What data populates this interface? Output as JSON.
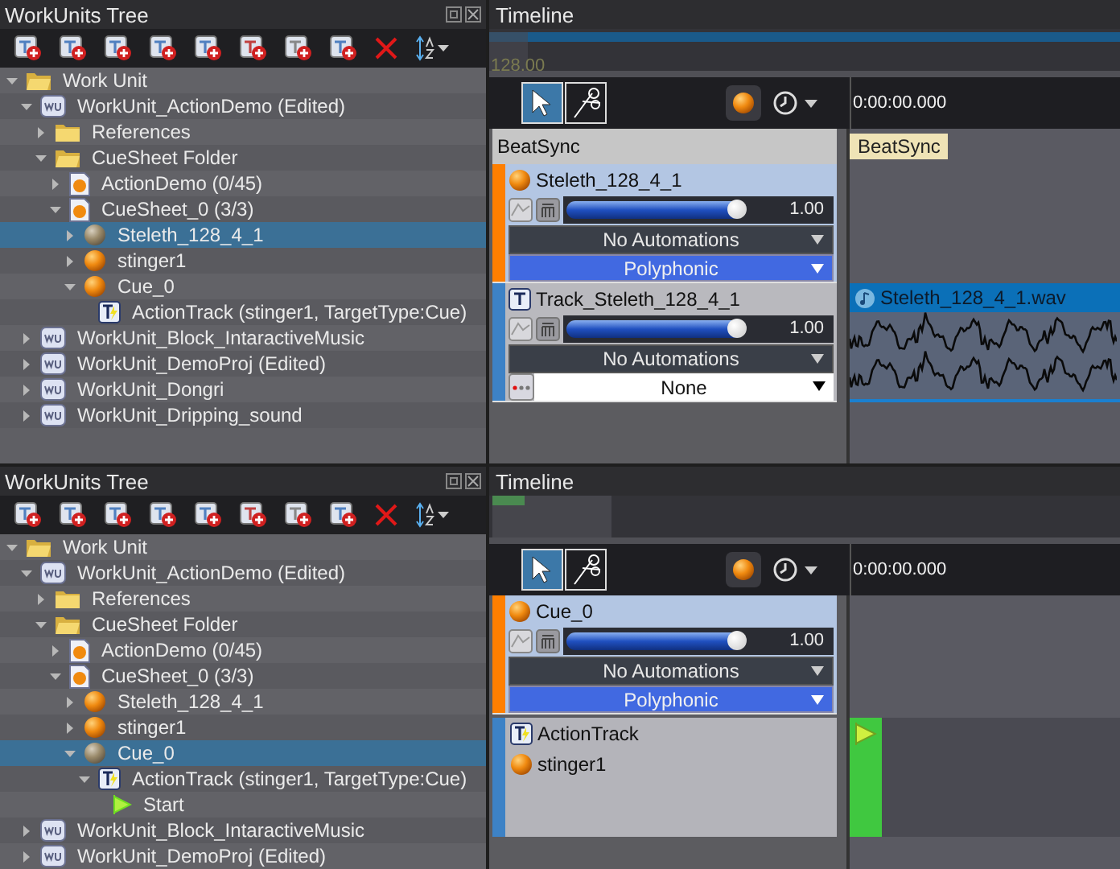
{
  "panels": [
    {
      "tree": {
        "title": "WorkUnits Tree",
        "nodes": [
          {
            "label": "Work Unit",
            "kind": "folder",
            "expanded": true,
            "selected": false,
            "children": [
              {
                "label": "WorkUnit_ActionDemo (Edited)",
                "kind": "workunit",
                "expanded": true,
                "selected": false,
                "children": [
                  {
                    "label": "References",
                    "kind": "folder",
                    "expanded": false,
                    "selected": false
                  },
                  {
                    "label": "CueSheet Folder",
                    "kind": "folder",
                    "expanded": true,
                    "selected": false,
                    "children": [
                      {
                        "label": "ActionDemo (0/45)",
                        "kind": "cuesheet",
                        "expanded": false,
                        "selected": false
                      },
                      {
                        "label": "CueSheet_0 (3/3)",
                        "kind": "cuesheet",
                        "expanded": true,
                        "selected": false,
                        "children": [
                          {
                            "label": "Steleth_128_4_1",
                            "kind": "cue",
                            "expanded": false,
                            "selected": true
                          },
                          {
                            "label": "stinger1",
                            "kind": "cue",
                            "expanded": false,
                            "selected": false
                          },
                          {
                            "label": "Cue_0",
                            "kind": "cue",
                            "expanded": true,
                            "selected": false,
                            "children": [
                              {
                                "label": "ActionTrack (stinger1, TargetType:Cue)",
                                "kind": "action",
                                "selected": false
                              }
                            ]
                          }
                        ]
                      }
                    ]
                  }
                ]
              },
              {
                "label": "WorkUnit_Block_IntaractiveMusic",
                "kind": "workunit",
                "expanded": false,
                "selected": false
              },
              {
                "label": "WorkUnit_DemoProj (Edited)",
                "kind": "workunit",
                "expanded": false,
                "selected": false
              },
              {
                "label": "WorkUnit_Dongri",
                "kind": "workunit",
                "expanded": false,
                "selected": false
              },
              {
                "label": "WorkUnit_Dripping_sound",
                "kind": "workunit",
                "expanded": false,
                "selected": false
              }
            ]
          }
        ]
      },
      "timeline": {
        "title": "Timeline",
        "overview": {
          "kind": "tempo",
          "reading": "128.00"
        },
        "tools": [
          {
            "kind": "pointer",
            "selected": true
          },
          {
            "kind": "scissors",
            "selected": false
          }
        ],
        "time": "0:00:00.000",
        "beat_sync": {
          "label": "BeatSync",
          "tag": "BeatSync"
        },
        "tracks": [
          {
            "kind": "cue",
            "name": "Steleth_128_4_1",
            "level": 0.95,
            "reading": "1.00",
            "automation": "No Automations",
            "mode": "Polyphonic"
          },
          {
            "kind": "track",
            "name": "Track_Steleth_128_4_1",
            "level": 0.95,
            "reading": "1.00",
            "automation": "No Automations",
            "output": "None",
            "clip": "Steleth_128_4_1.wav"
          }
        ]
      }
    },
    {
      "tree": {
        "title": "WorkUnits Tree",
        "nodes": [
          {
            "label": "Work Unit",
            "kind": "folder",
            "expanded": true,
            "selected": false,
            "children": [
              {
                "label": "WorkUnit_ActionDemo (Edited)",
                "kind": "workunit",
                "expanded": true,
                "selected": false,
                "children": [
                  {
                    "label": "References",
                    "kind": "folder",
                    "expanded": false,
                    "selected": false
                  },
                  {
                    "label": "CueSheet Folder",
                    "kind": "folder",
                    "expanded": true,
                    "selected": false,
                    "children": [
                      {
                        "label": "ActionDemo (0/45)",
                        "kind": "cuesheet",
                        "expanded": false,
                        "selected": false
                      },
                      {
                        "label": "CueSheet_0 (3/3)",
                        "kind": "cuesheet",
                        "expanded": true,
                        "selected": false,
                        "children": [
                          {
                            "label": "Steleth_128_4_1",
                            "kind": "cue",
                            "expanded": false,
                            "selected": false
                          },
                          {
                            "label": "stinger1",
                            "kind": "cue",
                            "expanded": false,
                            "selected": false
                          },
                          {
                            "label": "Cue_0",
                            "kind": "cue",
                            "expanded": true,
                            "selected": true,
                            "children": [
                              {
                                "label": "ActionTrack (stinger1, TargetType:Cue)",
                                "kind": "action",
                                "expanded": true,
                                "selected": false,
                                "children": [
                                  {
                                    "label": "Start",
                                    "kind": "marker",
                                    "selected": false
                                  }
                                ]
                              }
                            ]
                          }
                        ]
                      }
                    ]
                  }
                ]
              },
              {
                "label": "WorkUnit_Block_IntaractiveMusic",
                "kind": "workunit",
                "expanded": false,
                "selected": false
              },
              {
                "label": "WorkUnit_DemoProj (Edited)",
                "kind": "workunit",
                "expanded": false,
                "selected": false
              }
            ]
          }
        ]
      },
      "timeline": {
        "title": "Timeline",
        "overview": {
          "kind": "marker"
        },
        "tools": [
          {
            "kind": "pointer",
            "selected": true
          },
          {
            "kind": "scissors",
            "selected": false
          }
        ],
        "time": "0:00:00.000",
        "tracks": [
          {
            "kind": "cue",
            "name": "Cue_0",
            "level": 0.95,
            "reading": "1.00",
            "automation": "No Automations",
            "mode": "Polyphonic"
          },
          {
            "kind": "action",
            "items": [
              {
                "kind": "action",
                "label": "ActionTrack"
              },
              {
                "kind": "cue",
                "label": "stinger1"
              }
            ]
          }
        ]
      }
    }
  ]
}
